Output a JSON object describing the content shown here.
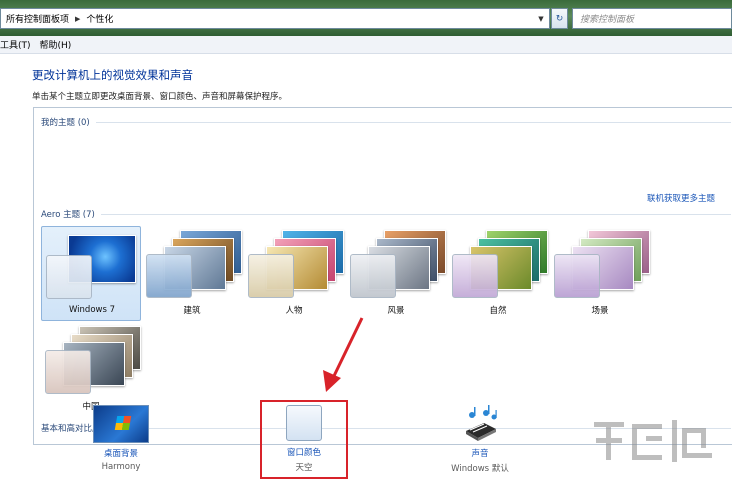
{
  "address_bar": {
    "path": [
      "所有控制面板项",
      "个性化"
    ],
    "search_placeholder": "搜索控制面板"
  },
  "menu": [
    "工具(T)",
    "帮助(H)"
  ],
  "page": {
    "title": "更改计算机上的视觉效果和声音",
    "description": "单击某个主题立即更改桌面背景、窗口颜色、声音和屏幕保护程序。"
  },
  "groups": {
    "my_themes": "我的主题 (0)",
    "aero_themes": "Aero 主题 (7)",
    "basic_themes": "基本和高对比度主题 (6)",
    "online_link": "联机获取更多主题"
  },
  "themes": [
    {
      "label": "Windows 7",
      "selected": true
    },
    {
      "label": "建筑",
      "selected": false
    },
    {
      "label": "人物",
      "selected": false
    },
    {
      "label": "风景",
      "selected": false
    },
    {
      "label": "自然",
      "selected": false
    },
    {
      "label": "场景",
      "selected": false
    },
    {
      "label": "中国",
      "selected": false
    }
  ],
  "bottom": {
    "background": {
      "title": "桌面背景",
      "subtitle": "Harmony"
    },
    "window_color": {
      "title": "窗口颜色",
      "subtitle": "天空"
    },
    "sound": {
      "title": "声音",
      "subtitle": "Windows 默认"
    }
  },
  "colors": {
    "accent": "#003399",
    "link": "#1a56b8",
    "highlight": "#d8232a"
  }
}
